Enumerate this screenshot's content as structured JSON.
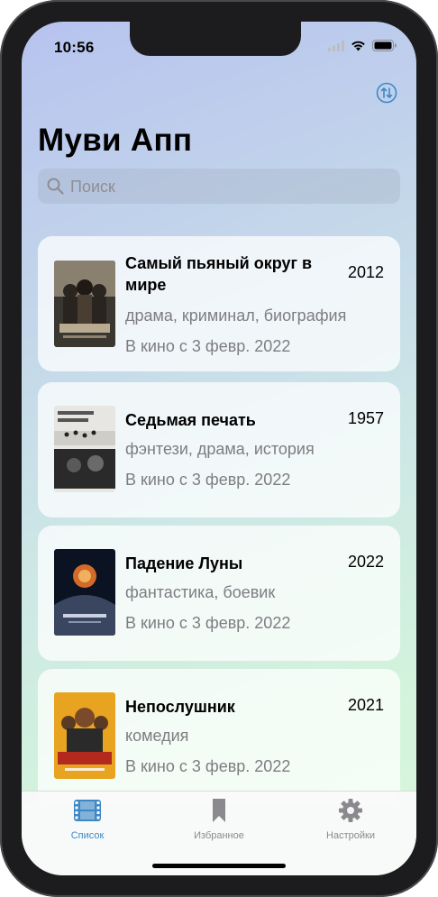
{
  "status": {
    "time": "10:56"
  },
  "header": {
    "title": "Муви Апп"
  },
  "search": {
    "placeholder": "Поиск"
  },
  "movies": [
    {
      "title": "Самый пьяный округ в мире",
      "year": "2012",
      "genres": "драма, криминал, биография",
      "release": "В кино с 3 февр. 2022",
      "poster_colors": [
        "#3a3630",
        "#c8b89a"
      ]
    },
    {
      "title": "Седьмая печать",
      "year": "1957",
      "genres": "фэнтези, драма, история",
      "release": "В кино с 3 февр. 2022",
      "poster_colors": [
        "#e8e6e2",
        "#2a2a2a"
      ]
    },
    {
      "title": "Падение Луны",
      "year": "2022",
      "genres": "фантастика, боевик",
      "release": "В кино с 3 февр. 2022",
      "poster_colors": [
        "#0b1222",
        "#d26b2a"
      ]
    },
    {
      "title": "Непослушник",
      "year": "2021",
      "genres": "комедия",
      "release": "В кино с 3 февр. 2022",
      "poster_colors": [
        "#e8a321",
        "#b22a1e"
      ]
    }
  ],
  "tabs": [
    {
      "label": "Список",
      "icon": "film-icon",
      "active": true
    },
    {
      "label": "Избранное",
      "icon": "bookmark-icon",
      "active": false
    },
    {
      "label": "Настройки",
      "icon": "gear-icon",
      "active": false
    }
  ],
  "colors": {
    "accent": "#3f88c6",
    "secondary_text": "#7d7d82",
    "inactive_tab": "#8a8a8e"
  }
}
